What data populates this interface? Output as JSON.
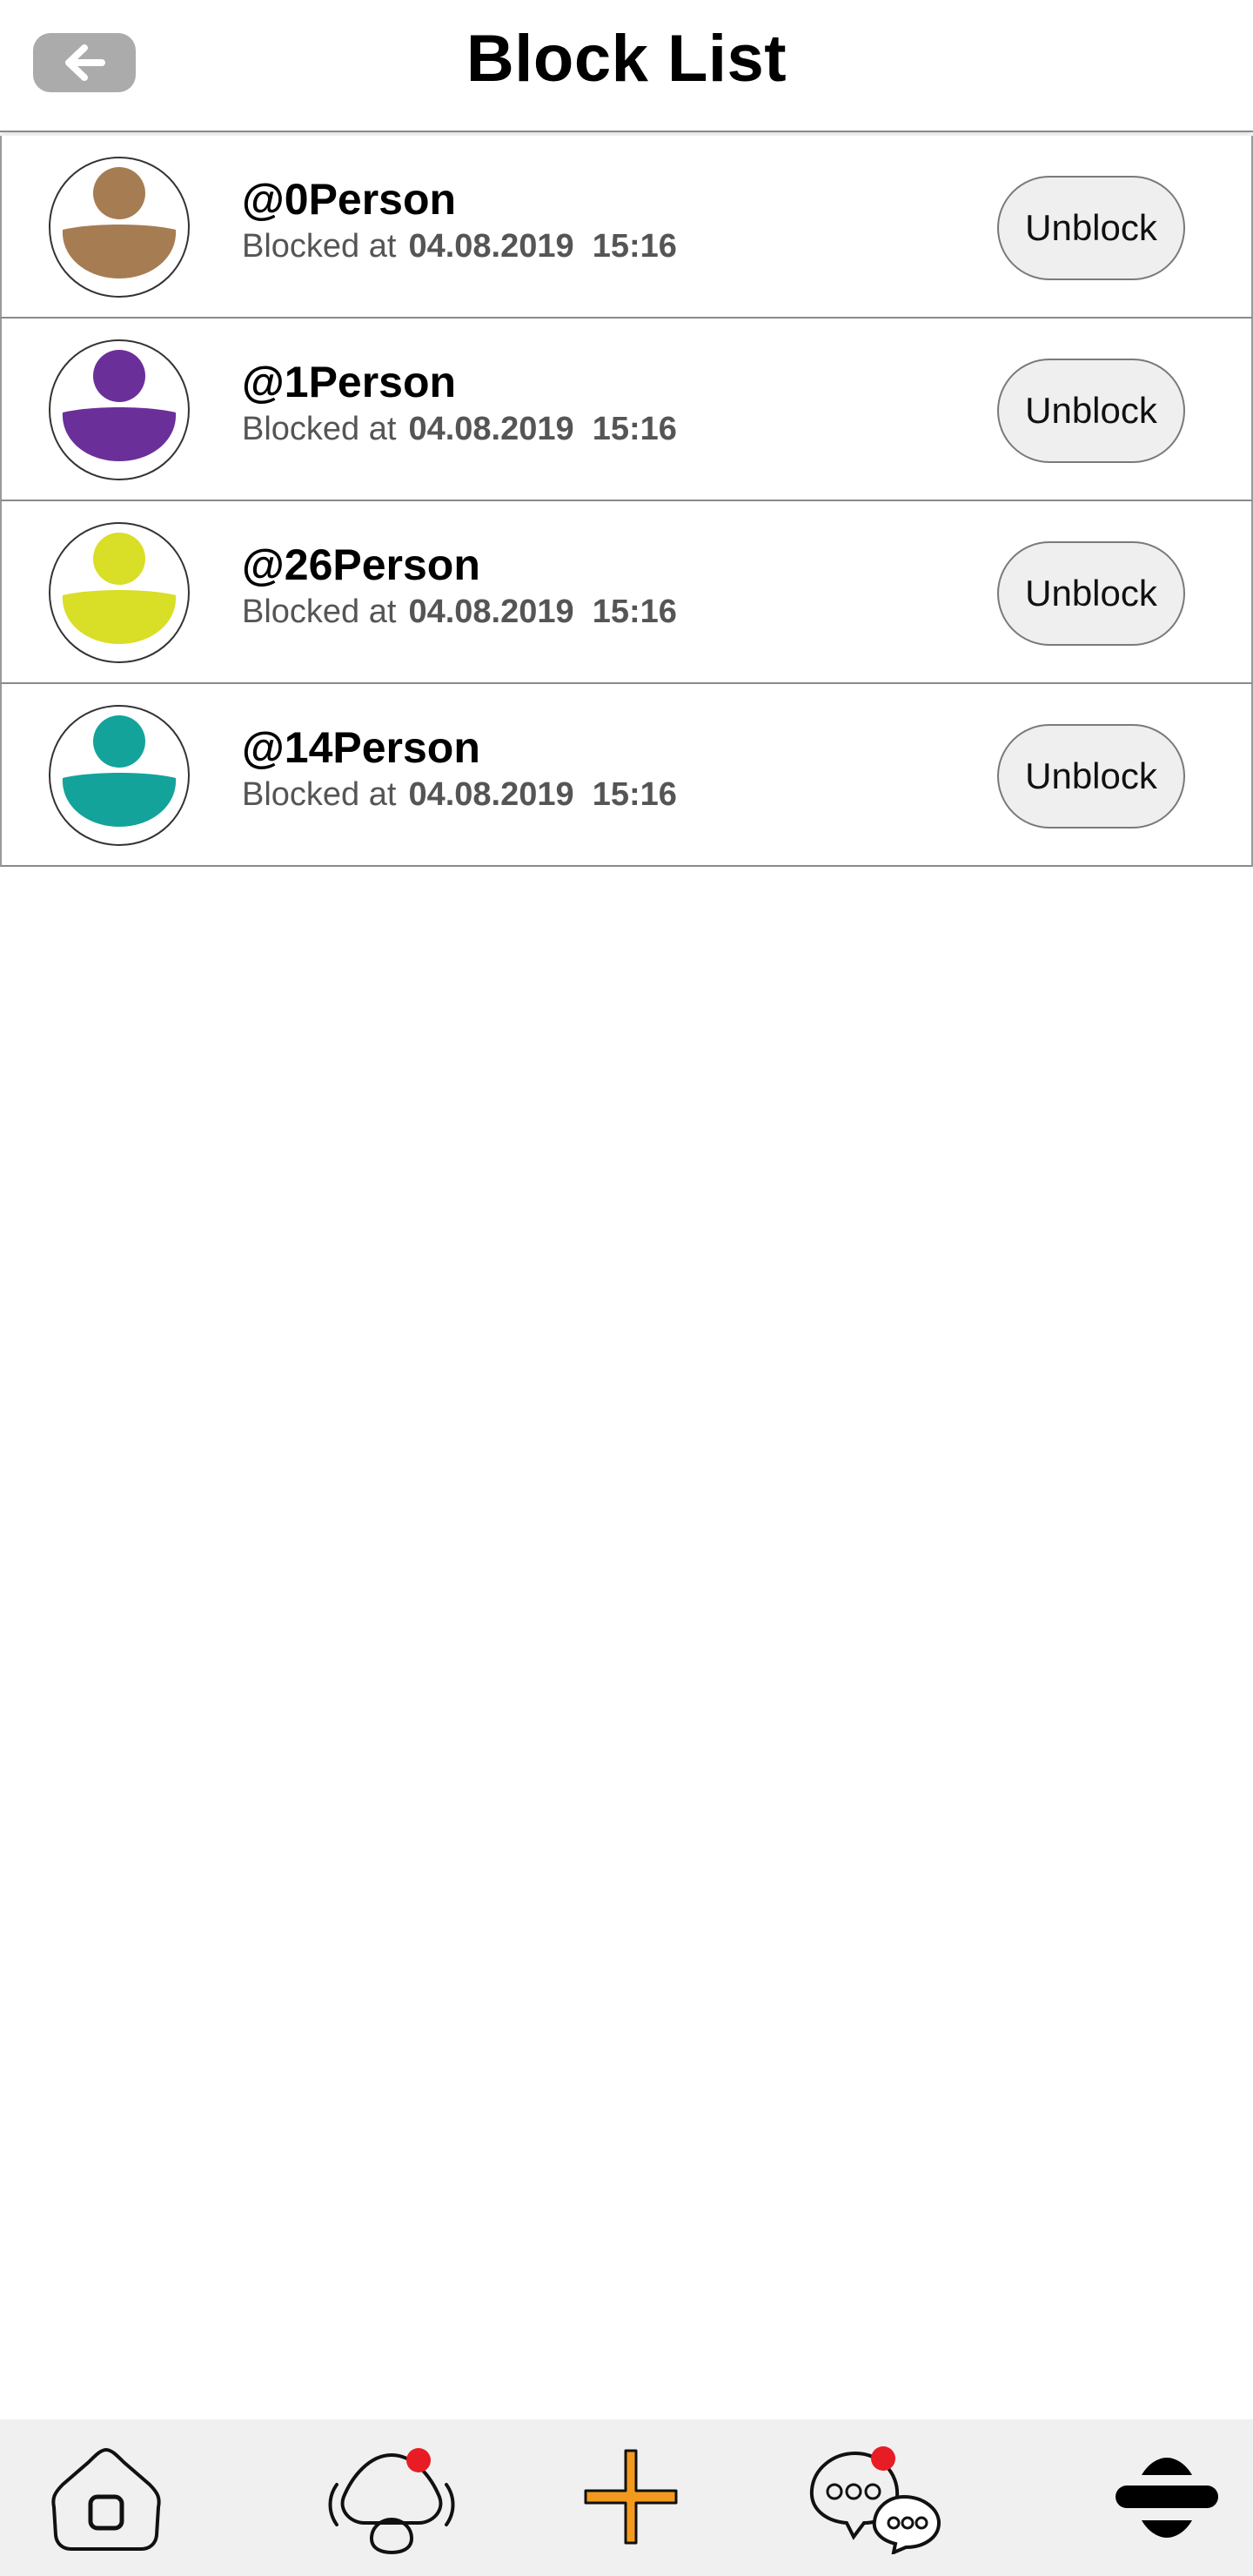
{
  "header": {
    "title": "Block List",
    "back_icon": "arrow-left-icon"
  },
  "blocked_users": [
    {
      "username": "@0Person",
      "blocked_label": "Blocked at",
      "blocked_at": "04.08.2019  15:16",
      "avatar_color": "#a67c52",
      "action_label": "Unblock"
    },
    {
      "username": "@1Person",
      "blocked_label": "Blocked at",
      "blocked_at": "04.08.2019  15:16",
      "avatar_color": "#6b2f9a",
      "action_label": "Unblock"
    },
    {
      "username": "@26Person",
      "blocked_label": "Blocked at",
      "blocked_at": "04.08.2019  15:16",
      "avatar_color": "#d9de26",
      "action_label": "Unblock"
    },
    {
      "username": "@14Person",
      "blocked_label": "Blocked at",
      "blocked_at": "04.08.2019  15:16",
      "avatar_color": "#14a39a",
      "action_label": "Unblock"
    }
  ],
  "tabbar": {
    "items": [
      {
        "icon": "home-icon",
        "badge": false
      },
      {
        "icon": "notifications-person-icon",
        "badge": true
      },
      {
        "icon": "add-plus-icon",
        "badge": false
      },
      {
        "icon": "chat-bubbles-icon",
        "badge": true
      },
      {
        "icon": "menu-icon",
        "badge": false
      }
    ],
    "accent_color": "#f39a1e",
    "badge_color": "#e81c24"
  }
}
